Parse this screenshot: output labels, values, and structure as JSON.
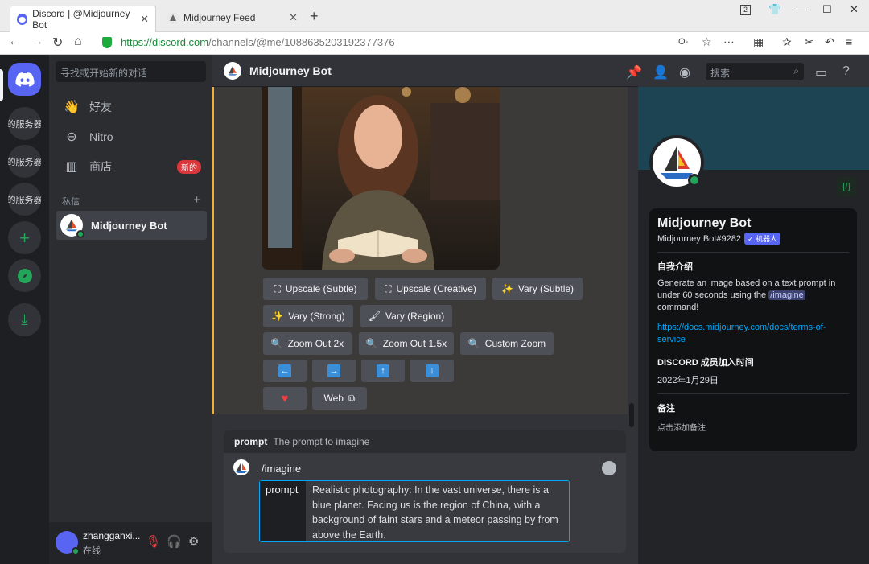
{
  "browser": {
    "tabs": [
      {
        "title": "Discord | @Midjourney Bot",
        "active": true
      },
      {
        "title": "Midjourney Feed",
        "active": false
      }
    ],
    "url_host": "https://discord.com",
    "url_path": "/channels/@me/1088635203192377376",
    "window_badge": "2"
  },
  "guilds": {
    "server_label": "的服务器"
  },
  "dmlist": {
    "search_placeholder": "寻找或开始新的对话",
    "nav": [
      {
        "label": "好友",
        "icon": "friends-icon"
      },
      {
        "label": "Nitro",
        "icon": "nitro-icon"
      },
      {
        "label": "商店",
        "icon": "shop-icon",
        "badge": "新的"
      }
    ],
    "dm_header": "私信",
    "dm_items": [
      {
        "name": "Midjourney Bot"
      }
    ]
  },
  "user": {
    "name": "zhangganxi...",
    "status": "在线"
  },
  "chat": {
    "title": "Midjourney Bot",
    "buttons": {
      "row1": [
        "Upscale (Subtle)",
        "Upscale (Creative)",
        "Vary (Subtle)"
      ],
      "row2": [
        "Vary (Strong)",
        "Vary (Region)"
      ],
      "row3": [
        "Zoom Out 2x",
        "Zoom Out 1.5x",
        "Custom Zoom"
      ],
      "row5_web": "Web"
    },
    "prompt_hint": {
      "name": "prompt",
      "desc": "The prompt to imagine"
    },
    "composer": {
      "command": "/imagine",
      "option_key": "prompt",
      "option_value": "Realistic photography: In the vast universe, there is a blue planet. Facing us is the region of China, with a background of faint stars and a meteor passing by from above the Earth."
    }
  },
  "header": {
    "search_placeholder": "搜索"
  },
  "profile": {
    "name": "Midjourney Bot",
    "tag": "Midjourney Bot#9282",
    "bot_badge": "✓ 机器人",
    "about_title": "自我介绍",
    "about_pre": "Generate an image based on a text prompt in under 60 seconds using the ",
    "about_cmd": "/imagine",
    "about_post": " command!",
    "link": "https://docs.midjourney.com/docs/terms-of-service",
    "member_title": "DISCORD 成员加入时间",
    "member_date": "2022年1月29日",
    "note_title": "备注",
    "note_placeholder": "点击添加备注"
  },
  "colors": {
    "blurple": "#5865f2",
    "online": "#23a55a",
    "link": "#00a8fc",
    "mention_border": "#f0b232"
  }
}
